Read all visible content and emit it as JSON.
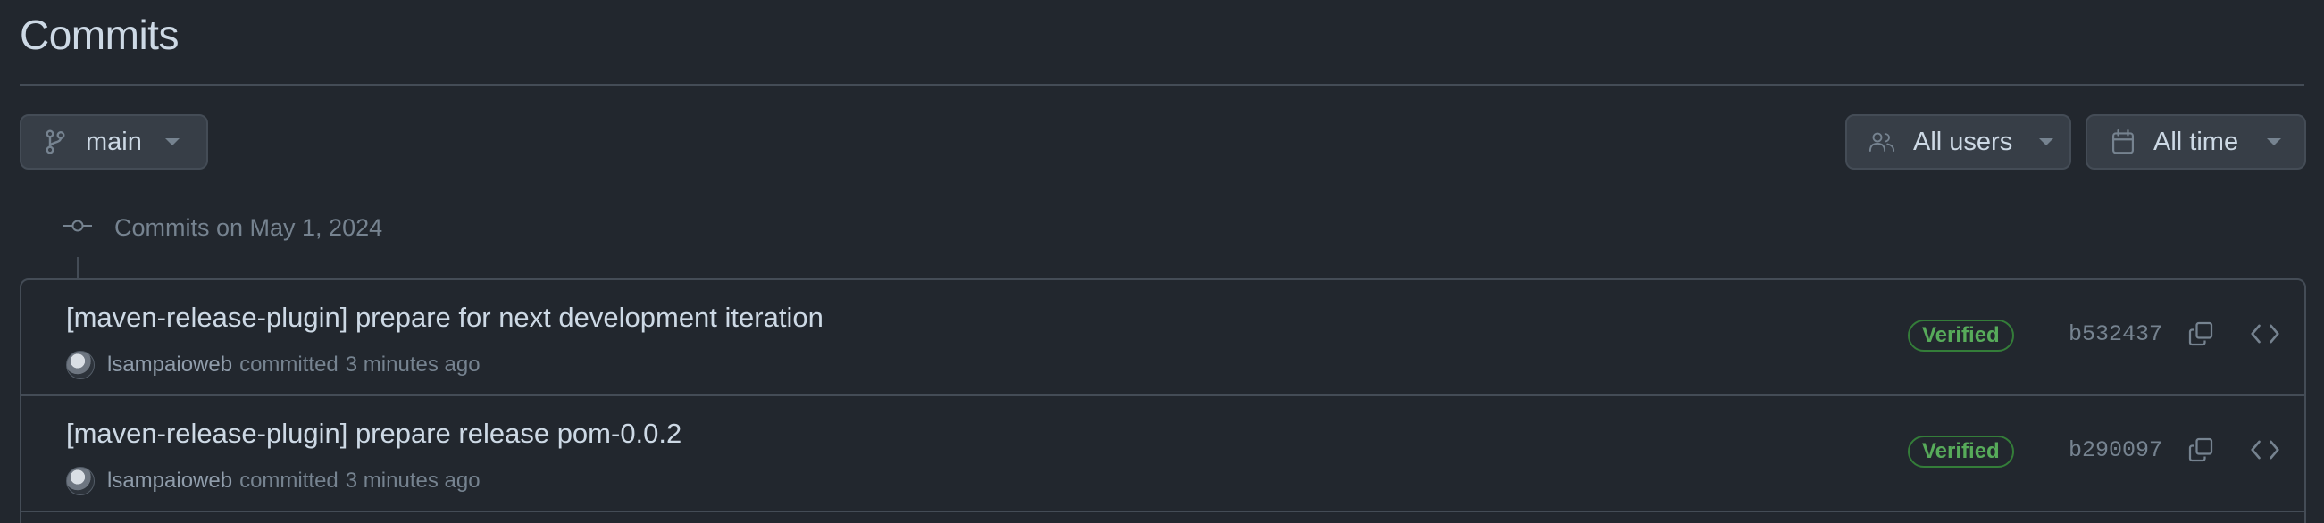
{
  "page": {
    "title": "Commits"
  },
  "filters": {
    "branch": {
      "label": "main",
      "icon": "git-branch-icon"
    },
    "users": {
      "label": "All users",
      "icon": "people-icon"
    },
    "time": {
      "label": "All time",
      "icon": "calendar-icon"
    }
  },
  "timeline": {
    "heading": "Commits on May 1, 2024",
    "icon": "git-commit-icon"
  },
  "commits": [
    {
      "message": "[maven-release-plugin] prepare for next development iteration",
      "author": "lsampaioweb",
      "action": "committed",
      "time": "3 minutes ago",
      "badge": "Verified",
      "sha": "b532437"
    },
    {
      "message": "[maven-release-plugin] prepare release pom-0.0.2",
      "author": "lsampaioweb",
      "action": "committed",
      "time": "3 minutes ago",
      "badge": "Verified",
      "sha": "b290097"
    }
  ],
  "colors": {
    "background": "#22272e",
    "border": "#444c56",
    "text": "#cdd9e5",
    "muted": "#768390",
    "verified": "#57ab5a"
  }
}
